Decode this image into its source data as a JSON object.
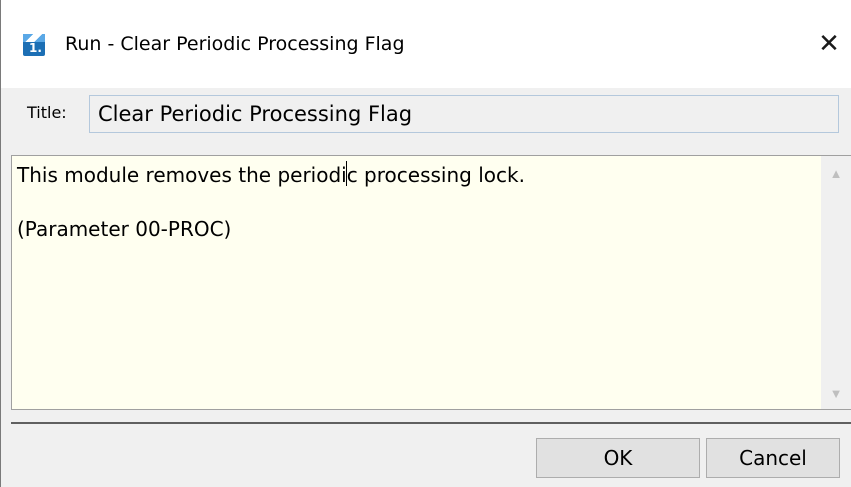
{
  "window": {
    "title": "Run - Clear Periodic Processing Flag",
    "icon": "app-logo-icon",
    "close_glyph": "✕"
  },
  "form": {
    "title_label": "Title:",
    "title_value": "Clear Periodic Processing Flag"
  },
  "description": {
    "line1": "This module removes the periodic processing lock.",
    "line2": "(Parameter 00-PROC)"
  },
  "scrollbar": {
    "up_glyph": "▲",
    "down_glyph": "▼"
  },
  "buttons": {
    "ok_label": "OK",
    "cancel_label": "Cancel"
  },
  "colors": {
    "description_bg": "#fffff0",
    "dialog_bg": "#f0f0f0",
    "icon_blue": "#1c6fb5"
  }
}
